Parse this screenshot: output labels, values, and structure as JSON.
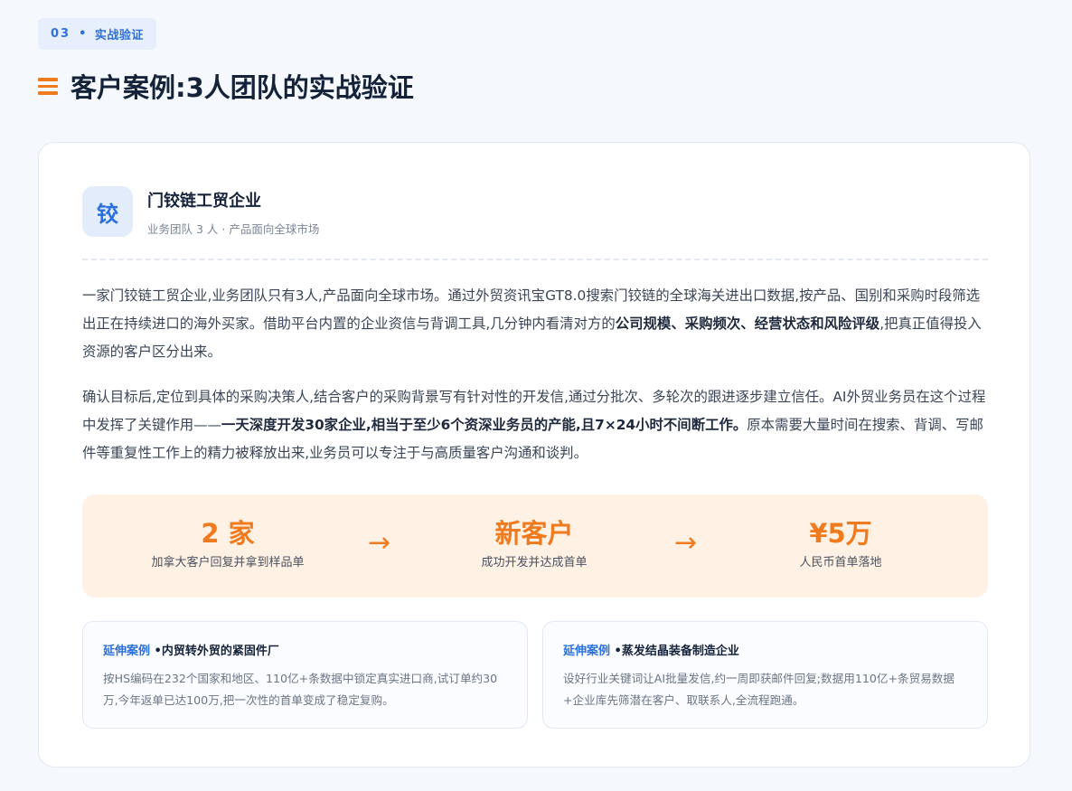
{
  "section": {
    "number": "03",
    "separator": "•",
    "label": "实战验证"
  },
  "page": {
    "title": "客户案例:3人团队的实战验证"
  },
  "company": {
    "logo_char": "铰",
    "name": "门铰链工贸企业",
    "subtitle": "业务团队 3 人 · 产品面向全球市场"
  },
  "paragraph1": {
    "t1": "一家门铰链工贸企业,业务团队只有3人,产品面向全球市场。通过外贸资讯宝GT8.0搜索门铰链的全球海关进出口数据,按产品、国别和采购时段筛选出正在持续进口的海外买家。借助平台内置的企业资信与背调工具,几分钟内看清对方的",
    "b1": "公司规模、采购频次、经营状态和风险评级",
    "t2": ",把真正值得投入资源的客户区分出来。"
  },
  "paragraph2": {
    "t1": "确认目标后,定位到具体的采购决策人,结合客户的采购背景写有针对性的开发信,通过分批次、多轮次的跟进逐步建立信任。AI外贸业务员在这个过程中发挥了关键作用——",
    "b1": "一天深度开发30家企业,相当于至少6个资深业务员的产能,且7×24小时不间断工作。",
    "t2": "原本需要大量时间在搜索、背调、写邮件等重复性工作上的精力被释放出来,业务员可以专注于与高质量客户沟通和谈判。"
  },
  "stats": [
    {
      "value": "2 家",
      "label": "加拿大客户回复并拿到样品单"
    },
    {
      "value": "新客户",
      "label": "成功开发并达成首单"
    },
    {
      "value": "¥5万",
      "label": "人民币首单落地"
    }
  ],
  "arrow_glyph": "→",
  "extensions": [
    {
      "tag": "延伸案例",
      "title": "•内贸转外贸的紧固件厂",
      "body": "按HS编码在232个国家和地区、110亿+条数据中锁定真实进口商,试订单约30万,今年返单已达100万,把一次性的首单变成了稳定复购。"
    },
    {
      "tag": "延伸案例",
      "title": "•蒸发结晶装备制造企业",
      "body": "设好行业关键词让AI批量发信,约一周即获邮件回复;数据用110亿+条贸易数据+企业库先筛潜在客户、取联系人,全流程跑通。"
    }
  ],
  "colors": {
    "accent_orange": "#f07a1e",
    "accent_blue": "#2b6fdc",
    "stats_background": "#fff1e3"
  }
}
